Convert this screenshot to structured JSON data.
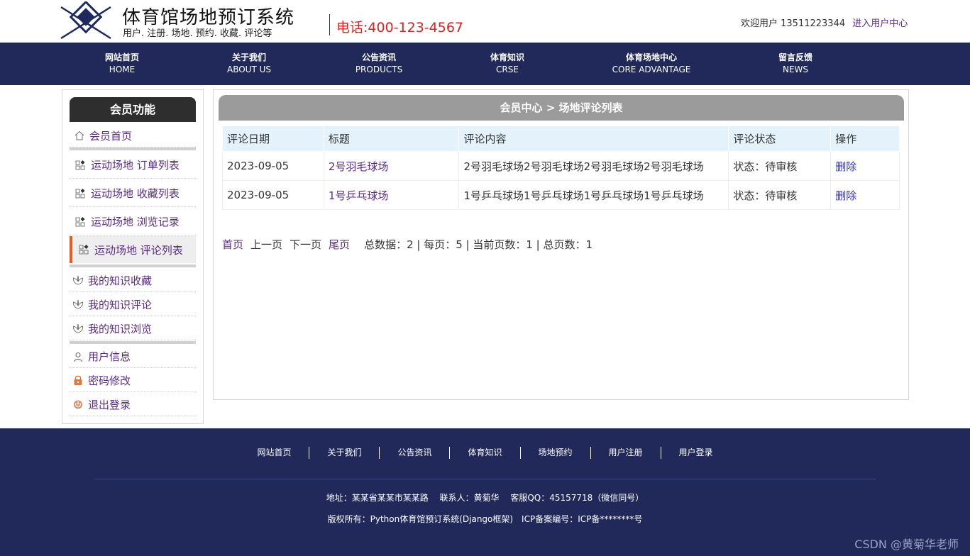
{
  "header": {
    "title": "体育馆场地预订系统",
    "subtitle": "用户. 注册. 场地. 预约. 收藏. 评论等",
    "phone": "电话:400-123-4567",
    "welcome": "欢迎用户 13511223344",
    "user_center_link": "进入用户中心"
  },
  "nav": [
    {
      "cn": "网站首页",
      "en": "HOME"
    },
    {
      "cn": "关于我们",
      "en": "ABOUT US"
    },
    {
      "cn": "公告资讯",
      "en": "PRODUCTS"
    },
    {
      "cn": "体育知识",
      "en": "CRSE"
    },
    {
      "cn": "体育场地中心",
      "en": "CORE ADVANTAGE"
    },
    {
      "cn": "留言反馈",
      "en": "NEWS"
    }
  ],
  "sidebar": {
    "title": "会员功能",
    "items": [
      {
        "label": "会员首页",
        "icon": "home-icon"
      },
      {
        "label": "运动场地 订单列表",
        "icon": "grid-icon"
      },
      {
        "label": "运动场地 收藏列表",
        "icon": "grid-icon"
      },
      {
        "label": "运动场地 浏览记录",
        "icon": "grid-icon"
      },
      {
        "label": "运动场地 评论列表",
        "icon": "grid-icon"
      },
      {
        "label": "我的知识收藏",
        "icon": "lotus-icon"
      },
      {
        "label": "我的知识评论",
        "icon": "lotus-icon"
      },
      {
        "label": "我的知识浏览",
        "icon": "lotus-icon"
      },
      {
        "label": "用户信息",
        "icon": "user-icon"
      },
      {
        "label": "密码修改",
        "icon": "lock-icon"
      },
      {
        "label": "退出登录",
        "icon": "power-icon"
      }
    ]
  },
  "main": {
    "heading": "会员中心 > 场地评论列表",
    "columns": [
      "评论日期",
      "标题",
      "评论内容",
      "评论状态",
      "操作"
    ],
    "rows": [
      {
        "date": "2023-09-05",
        "title": "2号羽毛球场",
        "content": "2号羽毛球场2号羽毛球场2号羽毛球场2号羽毛球场",
        "status": "状态：待审核",
        "action": "删除"
      },
      {
        "date": "2023-09-05",
        "title": "1号乒乓球场",
        "content": "1号乒乓球场1号乒乓球场1号乒乓球场1号乒乓球场",
        "status": "状态：待审核",
        "action": "删除"
      }
    ],
    "pager": {
      "first": "首页",
      "prev": "上一页",
      "next": "下一页",
      "last": "尾页",
      "stats": "总数据：2 | 每页：5 | 当前页数：1 | 总页数：1"
    }
  },
  "footer": {
    "links": [
      "网站首页",
      "关于我们",
      "公告资讯",
      "体育知识",
      "场地预约",
      "用户注册",
      "用户登录"
    ],
    "address_line": "地址：某某省某某市某某路　 联系人：黄菊华　 客服QQ：45157718（微信同号）",
    "copyright_line": "版权所有：Python体育馆预订系统(Django框架)　ICP备案编号：ICP备********号"
  },
  "watermark": "CSDN @黄菊华老师",
  "colors": {
    "nav_bg": "#21295a",
    "accent_red": "#e0201e",
    "link_purple": "#5b2a86",
    "active_bar": "#f05a1a",
    "table_head": "#e3f2fb"
  }
}
